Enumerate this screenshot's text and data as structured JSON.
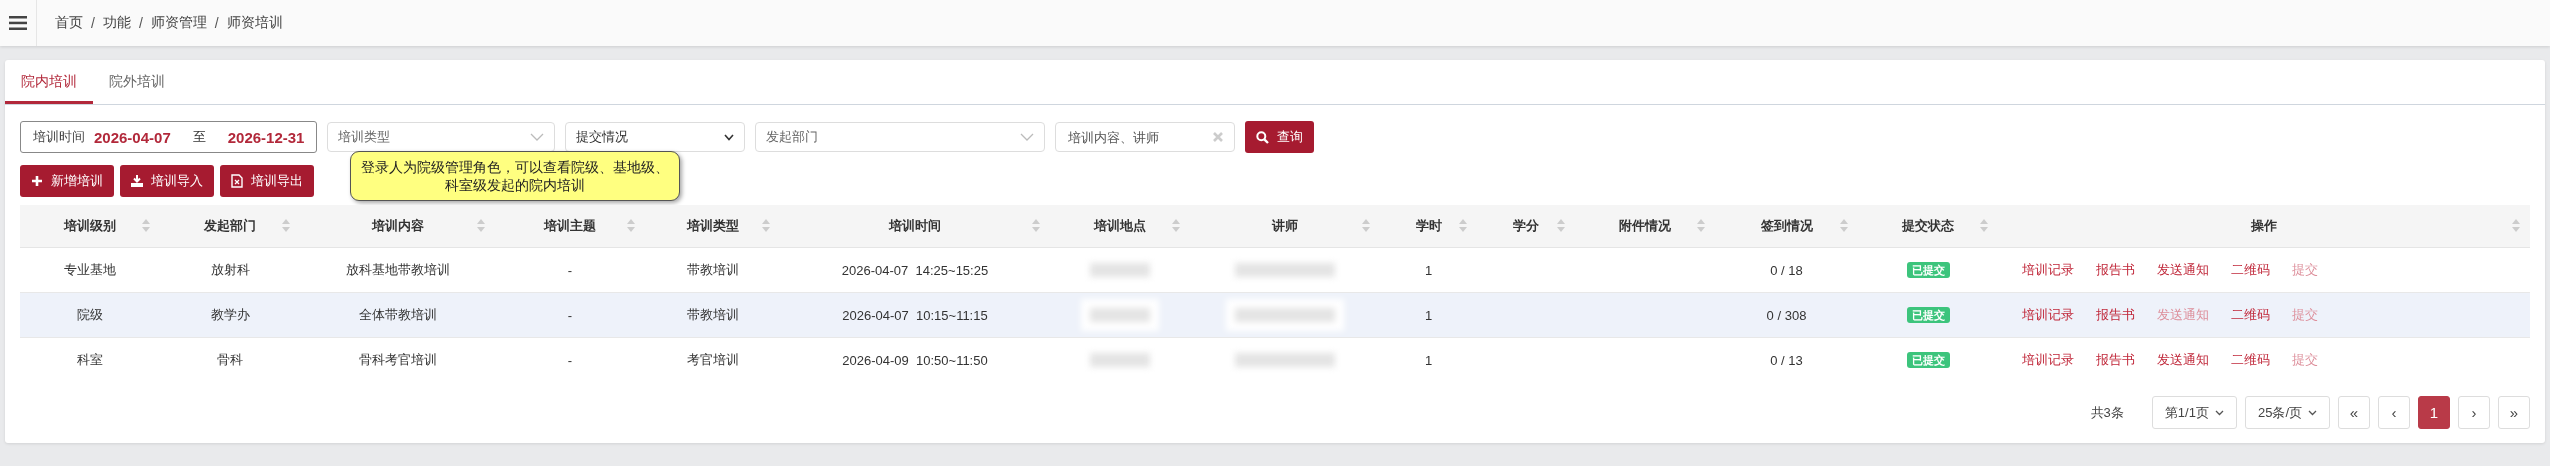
{
  "breadcrumb": [
    "首页",
    "功能",
    "师资管理",
    "师资培训"
  ],
  "breadcrumb_separators": [
    "/",
    "/",
    "/"
  ],
  "tabs": [
    {
      "label": "院内培训",
      "selected": true
    },
    {
      "label": "院外培训",
      "selected": false
    }
  ],
  "filters": {
    "date_range": {
      "label": "培训时间",
      "start": "2026-04-07",
      "separator": "至",
      "end": "2026-12-31"
    },
    "selects": [
      {
        "kind": "combo",
        "placeholder": "培训类型"
      },
      {
        "kind": "native",
        "value": "提交情况"
      },
      {
        "kind": "combo",
        "placeholder": "发起部门"
      }
    ],
    "search": {
      "placeholder": "培训内容、讲师"
    },
    "query_button": "查询"
  },
  "actions": [
    {
      "kind": "add",
      "label": "新增培训"
    },
    {
      "kind": "import",
      "label": "培训导入"
    },
    {
      "kind": "export",
      "label": "培训导出"
    }
  ],
  "tooltip": "登录人为院级管理角色，可以查看院级、基地级、科室级发起的院内培训",
  "table": {
    "columns": [
      "培训级别",
      "发起部门",
      "培训内容",
      "培训主题",
      "培训类型",
      "培训时间",
      "培训地点",
      "讲师",
      "学时",
      "学分",
      "附件情况",
      "签到情况",
      "提交状态",
      "操作"
    ],
    "rows": [
      {
        "selected": false,
        "level": "专业基地",
        "department": "放射科",
        "content": "放科基地带教培训",
        "topic": "-",
        "type": "带教培训",
        "date": "2026-04-07",
        "time": "14:25~15:25",
        "hours": "1",
        "signin": "0 / 18",
        "status": "已提交",
        "actions": [
          {
            "label": "培训记录",
            "disabled": false
          },
          {
            "label": "报告书",
            "disabled": false
          },
          {
            "label": "发送通知",
            "disabled": false
          },
          {
            "label": "二维码",
            "disabled": false
          },
          {
            "label": "提交",
            "disabled": true
          }
        ]
      },
      {
        "selected": true,
        "level": "院级",
        "department": "教学办",
        "content": "全体带教培训",
        "topic": "-",
        "type": "带教培训",
        "date": "2026-04-07",
        "time": "10:15~11:15",
        "hours": "1",
        "signin": "0 / 308",
        "status": "已提交",
        "actions": [
          {
            "label": "培训记录",
            "disabled": false
          },
          {
            "label": "报告书",
            "disabled": false
          },
          {
            "label": "发送通知",
            "disabled": true
          },
          {
            "label": "二维码",
            "disabled": false
          },
          {
            "label": "提交",
            "disabled": true
          }
        ]
      },
      {
        "selected": false,
        "level": "科室",
        "department": "骨科",
        "content": "骨科考官培训",
        "topic": "-",
        "type": "考官培训",
        "date": "2026-04-09",
        "time": "10:50~11:50",
        "hours": "1",
        "signin": "0 / 13",
        "status": "已提交",
        "actions": [
          {
            "label": "培训记录",
            "disabled": false
          },
          {
            "label": "报告书",
            "disabled": false
          },
          {
            "label": "发送通知",
            "disabled": false
          },
          {
            "label": "二维码",
            "disabled": false
          },
          {
            "label": "提交",
            "disabled": true
          }
        ]
      }
    ]
  },
  "pagination": {
    "total": "共3条",
    "page_select": "第1/1页",
    "size_select": "25条/页",
    "pages": [
      {
        "label": "«",
        "selected": false
      },
      {
        "label": "‹",
        "selected": false
      },
      {
        "label": "1",
        "selected": true
      },
      {
        "label": "›",
        "selected": false
      },
      {
        "label": "»",
        "selected": false
      }
    ]
  }
}
